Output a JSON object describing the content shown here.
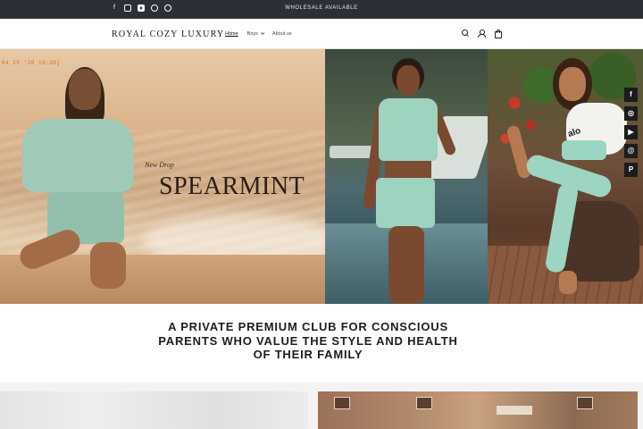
{
  "announcement": {
    "text": "WHOLESALE AVAILABLE",
    "social_icons": [
      "facebook-icon",
      "instagram-icon",
      "youtube-icon",
      "threads-icon",
      "pinterest-icon"
    ]
  },
  "header": {
    "logo": "ROYAL COZY LUXURY",
    "nav": [
      {
        "label": "Home",
        "active": true
      },
      {
        "label": "Boys",
        "has_dropdown": true
      },
      {
        "label": "About us"
      }
    ],
    "icons": [
      "search-icon",
      "account-icon",
      "cart-icon"
    ]
  },
  "hero": {
    "subtitle": "New Drop",
    "title": "SPEARMINT",
    "photo_timestamp": "04 25 '20 10:30]",
    "towel_brand": "alo"
  },
  "side_social": {
    "icons": [
      "facebook-icon",
      "instagram-icon",
      "youtube-icon",
      "threads-icon",
      "pinterest-icon"
    ],
    "glyphs": [
      "f",
      "◎",
      "▶",
      "@",
      "P"
    ]
  },
  "tagline": {
    "lines": [
      "A PRIVATE PREMIUM CLUB FOR CONSCIOUS",
      "PARENTS WHO VALUE THE STYLE AND HEALTH",
      "OF THEIR FAMILY"
    ]
  },
  "colors": {
    "announcement_bg": "#2c2f36",
    "accent_mint": "#9dd3bf",
    "text_dark": "#121212"
  }
}
